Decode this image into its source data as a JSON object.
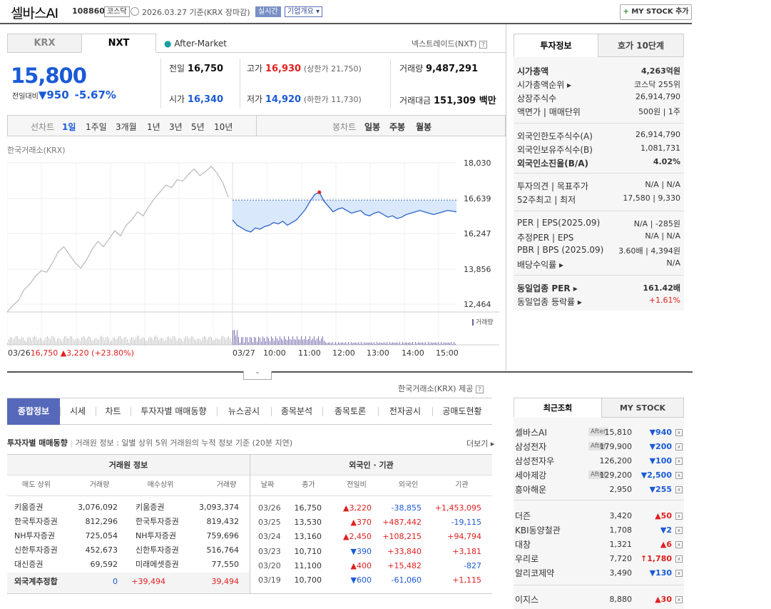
{
  "header": {
    "name": "셀바스AI",
    "code": "108860",
    "market": "코스닥",
    "date_text": "2026.03.27 기준(KRX 장마감)",
    "live_badge": "실시간",
    "company_btn": "기업개요 ▾",
    "mystock_plus": "+",
    "mystock_label": "MY STOCK 추가"
  },
  "tabs": {
    "krx": "KRX",
    "nxt": "NXT",
    "after_market": "After-Market",
    "nxt_link": "넥스트레이드(NXT)",
    "q": "?"
  },
  "price": {
    "current": "15,800",
    "prev_label": "전일대비",
    "change_arrow": "▼",
    "change": "950",
    "pct": "-5.67%"
  },
  "quote": {
    "prev_close_label": "전일",
    "prev_close": "16,750",
    "high_label": "고가",
    "high": "16,930",
    "upper_limit": "(상한가 21,750)",
    "volume_label": "거래량",
    "volume": "9,487,291",
    "open_label": "시가",
    "open": "16,340",
    "low_label": "저가",
    "low": "14,920",
    "lower_limit": "(하한가 11,730)",
    "amount_label": "거래대금",
    "amount": "151,309 백만"
  },
  "period_bar": {
    "line_label": "선차트",
    "periods": [
      "1일",
      "1주일",
      "3개월",
      "1년",
      "3년",
      "5년",
      "10년"
    ],
    "candle_label": "봉차트",
    "candles": [
      "일봉",
      "주봉",
      "월봉"
    ]
  },
  "chart_data": {
    "type": "line",
    "title": "한국거래소(KRX)",
    "y_ticks": [
      "18,030",
      "16,639",
      "16,247",
      "13,856",
      "12,464"
    ],
    "x_ticks": [
      "10:00",
      "11:00",
      "12:00",
      "13:00",
      "14:00",
      "15:00"
    ],
    "prev_date": "03/26",
    "prev_summary_price": "16,750",
    "prev_summary_change": "▲3,220 (+23.80%)",
    "cur_date": "03/27",
    "volume_label": "거래량",
    "ylim": [
      12464,
      18030
    ],
    "ref_price": 16639,
    "prev_series": [
      12464,
      12700,
      12900,
      13300,
      13500,
      13800,
      14000,
      13950,
      14300,
      14700,
      14900,
      14600,
      14300,
      14100,
      14400,
      14800,
      15100,
      14900,
      15200,
      15500,
      15300,
      15700,
      15900,
      16200,
      16050,
      16400,
      16700,
      16950,
      17200,
      17100,
      17400,
      17350,
      17600,
      17800,
      17550,
      17700,
      17900,
      17650,
      17300,
      16750
    ],
    "cur_series": [
      15900,
      15700,
      15600,
      15500,
      15450,
      15600,
      15550,
      15650,
      15700,
      15800,
      15750,
      15850,
      15700,
      15800,
      15900,
      16100,
      16300,
      16600,
      16850,
      16930,
      16600,
      16400,
      16200,
      16300,
      16350,
      16250,
      16150,
      16200,
      16250,
      16100,
      16050,
      16150,
      16200,
      16100,
      16000,
      16050,
      15950,
      16000,
      16100,
      16150,
      16200,
      16250,
      16200,
      16150,
      16100,
      16150,
      16200,
      16250,
      16230,
      16200
    ]
  },
  "source": "한국거래소(KRX) 제공",
  "right_tabs": {
    "info": "투자정보",
    "hoga": "호가 10단계"
  },
  "right_info": [
    {
      "k": "시가총액",
      "v": "4,263억원",
      "bold": true
    },
    {
      "k": "시가총액순위 ▸",
      "v": "코스닥 255위"
    },
    {
      "k": "상장주식수",
      "v": "26,914,790"
    },
    {
      "k": "액면가 | 매매단위",
      "v": "500원 | 1주"
    },
    {
      "k": "외국인한도주식수(A)",
      "v": "26,914,790"
    },
    {
      "k": "외국인보유주식수(B)",
      "v": "1,081,731"
    },
    {
      "k": "외국인소진율(B/A)",
      "v": "4.02%",
      "bold": true
    },
    {
      "k": "투자의견 | 목표주가",
      "v": "N/A | N/A"
    },
    {
      "k": "52주최고 | 최저",
      "v": "17,580 | 9,330"
    },
    {
      "k": "PER | EPS(2025.09)",
      "v": "N/A | -285원"
    },
    {
      "k": "추정PER | EPS",
      "v": "N/A | N/A"
    },
    {
      "k": "PBR | BPS (2025.09)",
      "v": "3.60배 | 4,394원"
    },
    {
      "k": "배당수익률 ▸",
      "v": "N/A"
    },
    {
      "k": "동일업종 PER ▸",
      "v": "161.42배",
      "bold": true
    },
    {
      "k": "동일업종 등락률 ▸",
      "v": "+1.61%",
      "red": true
    }
  ],
  "bottom_tabs": [
    "종합정보",
    "시세",
    "차트",
    "투자자별 매매동향",
    "뉴스공시",
    "종목분석",
    "종목토론",
    "전자공시",
    "공매도현황"
  ],
  "section": {
    "title": "투자자별 매매동향",
    "desc": "거래원 정보 : 일별 상위 5위 거래원의 누적 정보 기준 (20분 지연)",
    "more": "더보기 ▸"
  },
  "table": {
    "group1": "거래원 정보",
    "group2": "외국인 · 기관",
    "head_left": [
      "매도 상위",
      "거래량",
      "매수상위",
      "거래량"
    ],
    "head_right": [
      "날짜",
      "종가",
      "전일비",
      "외국인",
      "기관"
    ],
    "left_rows": [
      [
        "키움증권",
        "3,076,092",
        "키움증권",
        "3,093,374"
      ],
      [
        "한국투자증권",
        "812,296",
        "한국투자증권",
        "819,432"
      ],
      [
        "NH투자증권",
        "725,054",
        "NH투자증권",
        "759,696"
      ],
      [
        "신한투자증권",
        "452,673",
        "신한투자증권",
        "516,764"
      ],
      [
        "대신증권",
        "69,592",
        "미래에셋증권",
        "77,550"
      ]
    ],
    "foreign_label": "외국계추정합",
    "foreign_sell": "0",
    "foreign_diff": "+39,494",
    "foreign_buy": "39,494",
    "right_rows": [
      {
        "d": "03/26",
        "p": "16,750",
        "c": "▲3,220",
        "up": true,
        "f": "-38,855",
        "fup": false,
        "i": "+1,453,095",
        "iup": true
      },
      {
        "d": "03/25",
        "p": "13,530",
        "c": "▲370",
        "up": true,
        "f": "+487,442",
        "fup": true,
        "i": "-19,115",
        "iup": false
      },
      {
        "d": "03/24",
        "p": "13,160",
        "c": "▲2,450",
        "up": true,
        "f": "+108,215",
        "fup": true,
        "i": "+94,794",
        "iup": true
      },
      {
        "d": "03/23",
        "p": "10,710",
        "c": "▼390",
        "up": false,
        "f": "+33,840",
        "fup": true,
        "i": "+3,181",
        "iup": true
      },
      {
        "d": "03/20",
        "p": "11,100",
        "c": "▲400",
        "up": true,
        "f": "+15,482",
        "fup": true,
        "i": "-827",
        "iup": false
      },
      {
        "d": "03/19",
        "p": "10,700",
        "c": "▼600",
        "up": false,
        "f": "-61,060",
        "fup": false,
        "i": "+1,115",
        "iup": true
      }
    ]
  },
  "recent_tabs": {
    "recent": "최근조회",
    "my": "MY STOCK"
  },
  "recent": [
    {
      "n": "셀바스AI",
      "af": "After",
      "p": "15,810",
      "c": "▼940",
      "up": false
    },
    {
      "n": "삼성전자",
      "af": "After",
      "p": "179,900",
      "c": "▼200",
      "up": false
    },
    {
      "n": "삼성전자우",
      "af": "",
      "p": "126,200",
      "c": "▼100",
      "up": false
    },
    {
      "n": "세아제강",
      "af": "After",
      "p": "129,200",
      "c": "▼2,500",
      "up": false
    },
    {
      "n": "흥아해운",
      "af": "",
      "p": "2,950",
      "c": "▼255",
      "up": false
    },
    {
      "n": "더즌",
      "af": "",
      "p": "3,420",
      "c": "▲50",
      "up": true
    },
    {
      "n": "KBI동양철관",
      "af": "",
      "p": "1,708",
      "c": "▼2",
      "up": false
    },
    {
      "n": "대창",
      "af": "",
      "p": "1,321",
      "c": "▲6",
      "up": true
    },
    {
      "n": "우리로",
      "af": "",
      "p": "7,720",
      "c": "↑1,780",
      "up": true
    },
    {
      "n": "알리코제약",
      "af": "",
      "p": "3,490",
      "c": "▼130",
      "up": false
    },
    {
      "n": "이지스",
      "af": "",
      "p": "8,880",
      "c": "▲30",
      "up": true
    }
  ],
  "close": "x"
}
